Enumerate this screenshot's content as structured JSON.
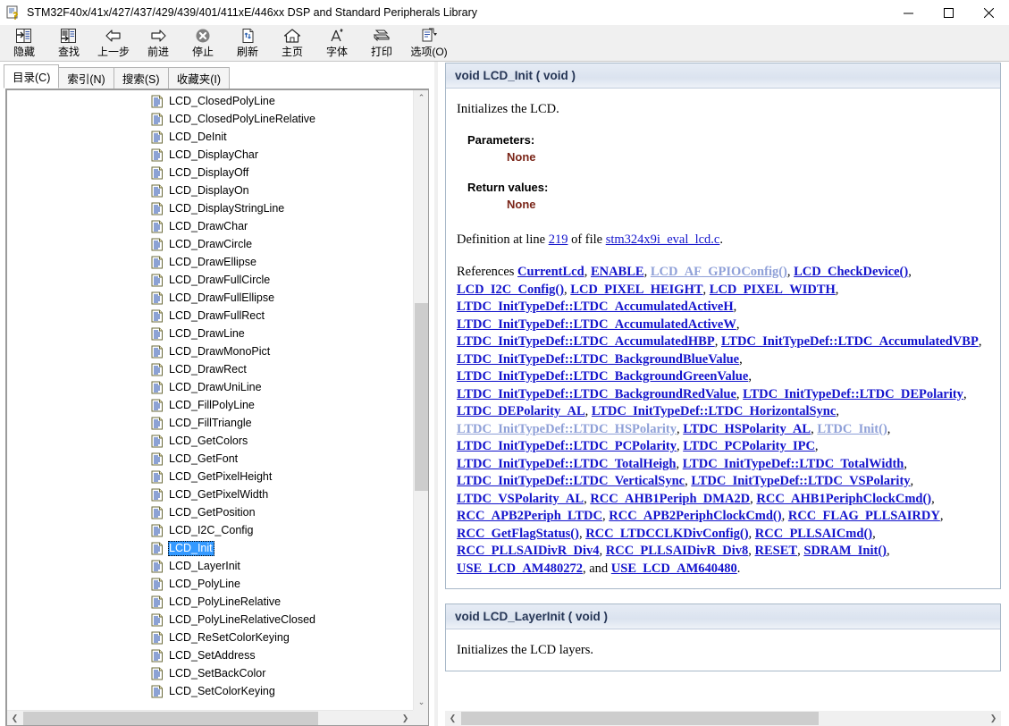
{
  "window": {
    "title": "STM32F40x/41x/427/437/429/439/401/411xE/446xx DSP and Standard Peripherals Library",
    "app_icon": "help-book-icon",
    "minimize": "—",
    "maximize": "☐",
    "close": "✕"
  },
  "toolbar": {
    "items": [
      {
        "label": "隐藏",
        "icon": "hide-pane-icon"
      },
      {
        "label": "查找",
        "icon": "find-icon"
      },
      {
        "label": "上一步",
        "icon": "back-arrow-icon"
      },
      {
        "label": "前进",
        "icon": "forward-arrow-icon"
      },
      {
        "label": "停止",
        "icon": "stop-icon"
      },
      {
        "label": "刷新",
        "icon": "refresh-icon"
      },
      {
        "label": "主页",
        "icon": "home-icon"
      },
      {
        "label": "字体",
        "icon": "font-icon"
      },
      {
        "label": "打印",
        "icon": "print-icon"
      },
      {
        "label": "选项(O)",
        "icon": "options-icon"
      }
    ]
  },
  "tabs": [
    {
      "label": "目录(C)",
      "accel": "C",
      "active": true
    },
    {
      "label": "索引(N)",
      "accel": "N",
      "active": false
    },
    {
      "label": "搜索(S)",
      "accel": "S",
      "active": false
    },
    {
      "label": "收藏夹(I)",
      "accel": "I",
      "active": false
    }
  ],
  "tree": {
    "icon": "document-page-icon",
    "selected": "LCD_Init",
    "items": [
      "LCD_ClosedPolyLine",
      "LCD_ClosedPolyLineRelative",
      "LCD_DeInit",
      "LCD_DisplayChar",
      "LCD_DisplayOff",
      "LCD_DisplayOn",
      "LCD_DisplayStringLine",
      "LCD_DrawChar",
      "LCD_DrawCircle",
      "LCD_DrawEllipse",
      "LCD_DrawFullCircle",
      "LCD_DrawFullEllipse",
      "LCD_DrawFullRect",
      "LCD_DrawLine",
      "LCD_DrawMonoPict",
      "LCD_DrawRect",
      "LCD_DrawUniLine",
      "LCD_FillPolyLine",
      "LCD_FillTriangle",
      "LCD_GetColors",
      "LCD_GetFont",
      "LCD_GetPixelHeight",
      "LCD_GetPixelWidth",
      "LCD_GetPosition",
      "LCD_I2C_Config",
      "LCD_Init",
      "LCD_LayerInit",
      "LCD_PolyLine",
      "LCD_PolyLineRelative",
      "LCD_PolyLineRelativeClosed",
      "LCD_ReSetColorKeying",
      "LCD_SetAddress",
      "LCD_SetBackColor",
      "LCD_SetColorKeying"
    ]
  },
  "content": {
    "section1": {
      "proto": "void LCD_Init ( void   )",
      "brief": "Initializes the LCD.",
      "params_label": "Parameters:",
      "params_value": "None",
      "returns_label": "Return values:",
      "returns_value": "None",
      "definition_prefix": "Definition at line ",
      "definition_line": "219",
      "definition_middle": " of file ",
      "definition_file": "stm324x9i_eval_lcd.c",
      "definition_suffix": ".",
      "references_label": "References ",
      "references_and": "and",
      "references": [
        {
          "text": "CurrentLcd",
          "dim": false
        },
        {
          "text": "ENABLE",
          "dim": false
        },
        {
          "text": "LCD_AF_GPIOConfig()",
          "dim": true
        },
        {
          "text": "LCD_CheckDevice()",
          "dim": false
        },
        {
          "text": "LCD_I2C_Config()",
          "dim": false
        },
        {
          "text": "LCD_PIXEL_HEIGHT",
          "dim": false
        },
        {
          "text": "LCD_PIXEL_WIDTH",
          "dim": false
        },
        {
          "text": "LTDC_InitTypeDef::LTDC_AccumulatedActiveH",
          "dim": false
        },
        {
          "text": "LTDC_InitTypeDef::LTDC_AccumulatedActiveW",
          "dim": false
        },
        {
          "text": "LTDC_InitTypeDef::LTDC_AccumulatedHBP",
          "dim": false
        },
        {
          "text": "LTDC_InitTypeDef::LTDC_AccumulatedVBP",
          "dim": false
        },
        {
          "text": "LTDC_InitTypeDef::LTDC_BackgroundBlueValue",
          "dim": false
        },
        {
          "text": "LTDC_InitTypeDef::LTDC_BackgroundGreenValue",
          "dim": false
        },
        {
          "text": "LTDC_InitTypeDef::LTDC_BackgroundRedValue",
          "dim": false
        },
        {
          "text": "LTDC_InitTypeDef::LTDC_DEPolarity",
          "dim": false
        },
        {
          "text": "LTDC_DEPolarity_AL",
          "dim": false
        },
        {
          "text": "LTDC_InitTypeDef::LTDC_HorizontalSync",
          "dim": false
        },
        {
          "text": "LTDC_InitTypeDef::LTDC_HSPolarity",
          "dim": true
        },
        {
          "text": "LTDC_HSPolarity_AL",
          "dim": false
        },
        {
          "text": "LTDC_Init()",
          "dim": true
        },
        {
          "text": "LTDC_InitTypeDef::LTDC_PCPolarity",
          "dim": false
        },
        {
          "text": "LTDC_PCPolarity_IPC",
          "dim": false
        },
        {
          "text": "LTDC_InitTypeDef::LTDC_TotalHeigh",
          "dim": false
        },
        {
          "text": "LTDC_InitTypeDef::LTDC_TotalWidth",
          "dim": false
        },
        {
          "text": "LTDC_InitTypeDef::LTDC_VerticalSync",
          "dim": false
        },
        {
          "text": "LTDC_InitTypeDef::LTDC_VSPolarity",
          "dim": false
        },
        {
          "text": "LTDC_VSPolarity_AL",
          "dim": false
        },
        {
          "text": "RCC_AHB1Periph_DMA2D",
          "dim": false
        },
        {
          "text": "RCC_AHB1PeriphClockCmd()",
          "dim": false
        },
        {
          "text": "RCC_APB2Periph_LTDC",
          "dim": false
        },
        {
          "text": "RCC_APB2PeriphClockCmd()",
          "dim": false
        },
        {
          "text": "RCC_FLAG_PLLSAIRDY",
          "dim": false
        },
        {
          "text": "RCC_GetFlagStatus()",
          "dim": false
        },
        {
          "text": "RCC_LTDCCLKDivConfig()",
          "dim": false
        },
        {
          "text": "RCC_PLLSAICmd()",
          "dim": false
        },
        {
          "text": "RCC_PLLSAIDivR_Div4",
          "dim": false
        },
        {
          "text": "RCC_PLLSAIDivR_Div8",
          "dim": false
        },
        {
          "text": "RESET",
          "dim": false
        },
        {
          "text": "SDRAM_Init()",
          "dim": false
        },
        {
          "text": "USE_LCD_AM480272",
          "dim": false
        },
        {
          "text": "USE_LCD_AM640480",
          "dim": false
        }
      ]
    },
    "section2": {
      "proto": "void LCD_LayerInit ( void   )",
      "brief": "Initializes the LCD layers."
    }
  },
  "scrollbars": {
    "up_arrow": "⌃",
    "down_arrow": "⌄",
    "left_arrow": "❮",
    "right_arrow": "❯"
  },
  "colors": {
    "selection": "#3399ff",
    "link": "#1414cc",
    "link_dim": "#8fa0d8",
    "param_value": "#7a2518",
    "proto_bg": "#dbe3ef",
    "toolbar_bg": "#f0f0f0"
  }
}
